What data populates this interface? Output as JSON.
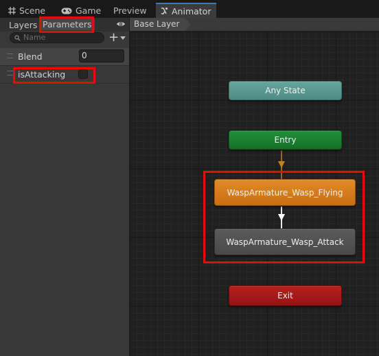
{
  "tabs": [
    {
      "label": "Scene",
      "icon": "grid-icon"
    },
    {
      "label": "Game",
      "icon": "gamepad-icon"
    },
    {
      "label": "Preview",
      "icon": ""
    },
    {
      "label": "Animator",
      "icon": "animator-icon",
      "active": true
    }
  ],
  "left_panel": {
    "subtabs": {
      "layers": "Layers",
      "parameters": "Parameters"
    },
    "search_placeholder": "Name",
    "add_button": "+",
    "parameters": [
      {
        "name": "Blend",
        "type": "float",
        "value": "0"
      },
      {
        "name": "isAttacking",
        "type": "bool",
        "value": false
      }
    ]
  },
  "graph": {
    "breadcrumb": "Base Layer",
    "nodes": {
      "any_state": "Any State",
      "entry": "Entry",
      "flying": "WaspArmature_Wasp_Flying",
      "attack": "WaspArmature_Wasp_Attack",
      "exit": "Exit"
    }
  },
  "colors": {
    "highlight": "#e30d0d",
    "any_state": "#58968f",
    "entry": "#1a8030",
    "default_state": "#d07a1c",
    "state": "#505050",
    "exit": "#a81a1a"
  }
}
